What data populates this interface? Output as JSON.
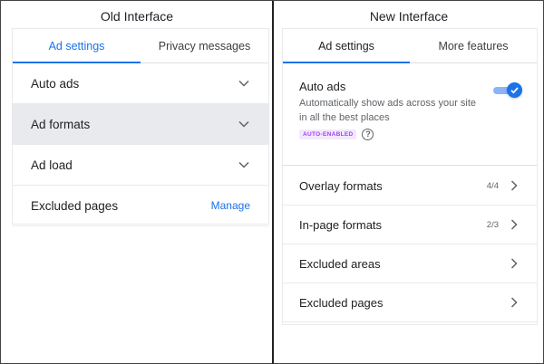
{
  "old_panel": {
    "caption": "Old Interface",
    "tabs": [
      {
        "label": "Ad settings",
        "active": true
      },
      {
        "label": "Privacy messages",
        "active": false
      }
    ],
    "rows": [
      {
        "label": "Auto ads",
        "control": "chevron-down-icon",
        "highlighted": false
      },
      {
        "label": "Ad formats",
        "control": "chevron-down-icon",
        "highlighted": true
      },
      {
        "label": "Ad load",
        "control": "chevron-down-icon",
        "highlighted": false
      },
      {
        "label": "Excluded pages",
        "control": "link",
        "link_label": "Manage",
        "highlighted": false
      }
    ]
  },
  "new_panel": {
    "caption": "New Interface",
    "tabs": [
      {
        "label": "Ad settings",
        "active": true
      },
      {
        "label": "More features",
        "active": false
      }
    ],
    "auto_ads": {
      "title": "Auto ads",
      "description": "Automatically show ads across your site in all the best places",
      "badge": "AUTO-ENABLED",
      "help_icon": "question-mark-icon",
      "toggle_on": true
    },
    "rows": [
      {
        "label": "Overlay formats",
        "count": "4/4",
        "control": "chevron-right-icon"
      },
      {
        "label": "In-page formats",
        "count": "2/3",
        "control": "chevron-right-icon"
      },
      {
        "label": "Excluded areas",
        "count": "",
        "control": "chevron-right-icon"
      },
      {
        "label": "Excluded pages",
        "count": "",
        "control": "chevron-right-icon"
      }
    ]
  },
  "colors": {
    "accent": "#1a73e8",
    "highlight_row": "#e8eaed",
    "badge_text": "#a142f4",
    "badge_bg": "#f3e8fd"
  }
}
